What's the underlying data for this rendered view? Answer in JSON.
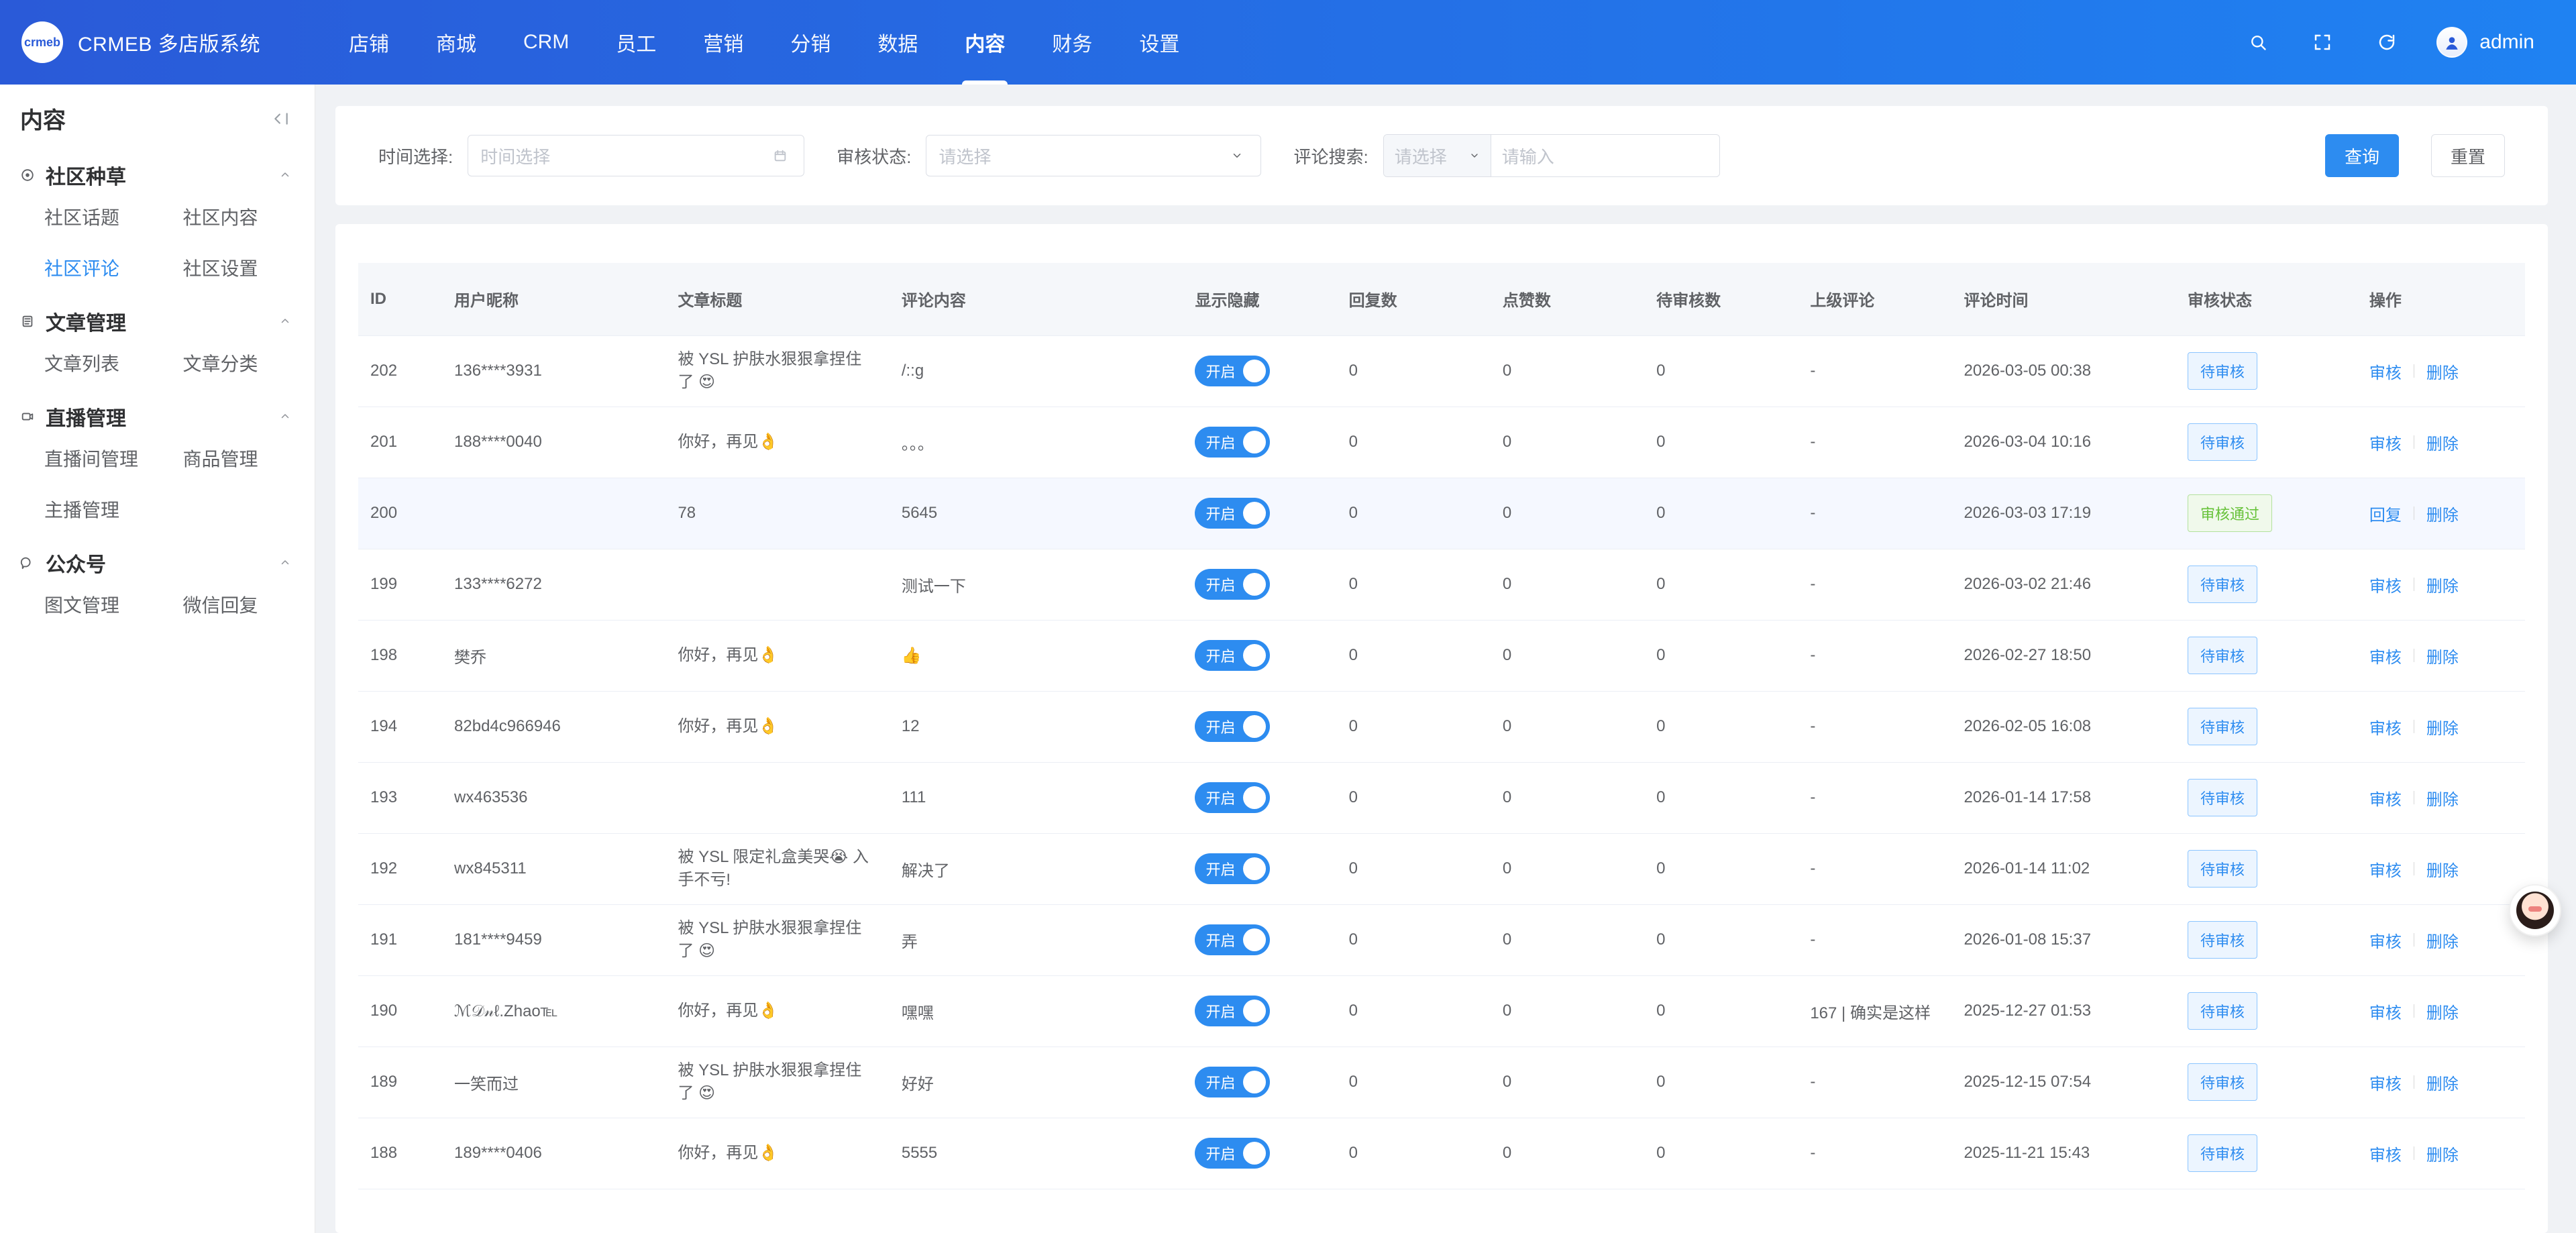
{
  "brand": {
    "logo_text": "crmeb",
    "title": "CRMEB 多店版系统"
  },
  "topnav": {
    "items": [
      {
        "label": "店铺",
        "active": false
      },
      {
        "label": "商城",
        "active": false
      },
      {
        "label": "CRM",
        "active": false
      },
      {
        "label": "员工",
        "active": false
      },
      {
        "label": "营销",
        "active": false
      },
      {
        "label": "分销",
        "active": false
      },
      {
        "label": "数据",
        "active": false
      },
      {
        "label": "内容",
        "active": true
      },
      {
        "label": "财务",
        "active": false
      },
      {
        "label": "设置",
        "active": false
      }
    ],
    "user": {
      "name": "admin"
    }
  },
  "sidebar": {
    "title": "内容",
    "groups": [
      {
        "title": "社区种草",
        "icon": "community-icon",
        "items": [
          {
            "label": "社区话题",
            "active": false
          },
          {
            "label": "社区内容",
            "active": false
          },
          {
            "label": "社区评论",
            "active": true
          },
          {
            "label": "社区设置",
            "active": false
          }
        ]
      },
      {
        "title": "文章管理",
        "icon": "document-icon",
        "items": [
          {
            "label": "文章列表",
            "active": false
          },
          {
            "label": "文章分类",
            "active": false
          }
        ]
      },
      {
        "title": "直播管理",
        "icon": "live-icon",
        "items": [
          {
            "label": "直播间管理",
            "active": false
          },
          {
            "label": "商品管理",
            "active": false
          },
          {
            "label": "主播管理",
            "active": false
          }
        ]
      },
      {
        "title": "公众号",
        "icon": "chat-icon",
        "items": [
          {
            "label": "图文管理",
            "active": false
          },
          {
            "label": "微信回复",
            "active": false
          }
        ]
      }
    ]
  },
  "filters": {
    "time": {
      "label": "时间选择:",
      "placeholder": "时间选择"
    },
    "status": {
      "label": "审核状态:",
      "placeholder": "请选择"
    },
    "comment": {
      "label": "评论搜索:",
      "select_placeholder": "请选择",
      "input_placeholder": "请输入"
    },
    "buttons": {
      "query": "查询",
      "reset": "重置"
    }
  },
  "table": {
    "headers": [
      "ID",
      "用户昵称",
      "文章标题",
      "评论内容",
      "显示隐藏",
      "回复数",
      "点赞数",
      "待审核数",
      "上级评论",
      "评论时间",
      "审核状态",
      "操作"
    ],
    "switch_label": "开启",
    "ops": {
      "audit": "审核",
      "reply": "回复",
      "delete": "删除"
    },
    "rows": [
      {
        "id": "202",
        "nick": "136****3931",
        "title": "被 YSL 护肤水狠狠拿捏住了 😍",
        "content": "/::g",
        "replies": "0",
        "likes": "0",
        "pending": "0",
        "parent": "-",
        "time": "2026-03-05 00:38",
        "status": "待审核",
        "status_type": "pending",
        "ops_type": "audit"
      },
      {
        "id": "201",
        "nick": "188****0040",
        "title": "你好，再见👌",
        "content": "。。。",
        "replies": "0",
        "likes": "0",
        "pending": "0",
        "parent": "-",
        "time": "2026-03-04 10:16",
        "status": "待审核",
        "status_type": "pending",
        "ops_type": "audit"
      },
      {
        "id": "200",
        "nick": "",
        "title": "78",
        "content": "5645",
        "replies": "0",
        "likes": "0",
        "pending": "0",
        "parent": "-",
        "time": "2026-03-03 17:19",
        "status": "审核通过",
        "status_type": "pass",
        "ops_type": "reply",
        "highlight": true
      },
      {
        "id": "199",
        "nick": "133****6272",
        "title": "",
        "content": "测试一下",
        "replies": "0",
        "likes": "0",
        "pending": "0",
        "parent": "-",
        "time": "2026-03-02 21:46",
        "status": "待审核",
        "status_type": "pending",
        "ops_type": "audit"
      },
      {
        "id": "198",
        "nick": "樊乔",
        "title": "你好，再见👌",
        "content": "👍",
        "replies": "0",
        "likes": "0",
        "pending": "0",
        "parent": "-",
        "time": "2026-02-27 18:50",
        "status": "待审核",
        "status_type": "pending",
        "ops_type": "audit"
      },
      {
        "id": "194",
        "nick": "82bd4c966946",
        "title": "你好，再见👌",
        "content": "12",
        "replies": "0",
        "likes": "0",
        "pending": "0",
        "parent": "-",
        "time": "2026-02-05 16:08",
        "status": "待审核",
        "status_type": "pending",
        "ops_type": "audit"
      },
      {
        "id": "193",
        "nick": "wx463536",
        "title": "",
        "content": "111",
        "replies": "0",
        "likes": "0",
        "pending": "0",
        "parent": "-",
        "time": "2026-01-14 17:58",
        "status": "待审核",
        "status_type": "pending",
        "ops_type": "audit"
      },
      {
        "id": "192",
        "nick": "wx845311",
        "title": "被 YSL 限定礼盒美哭😭 入手不亏!",
        "content": "解决了",
        "replies": "0",
        "likes": "0",
        "pending": "0",
        "parent": "-",
        "time": "2026-01-14 11:02",
        "status": "待审核",
        "status_type": "pending",
        "ops_type": "audit"
      },
      {
        "id": "191",
        "nick": "181****9459",
        "title": "被 YSL 护肤水狠狠拿捏住了 😍",
        "content": "弄",
        "replies": "0",
        "likes": "0",
        "pending": "0",
        "parent": "-",
        "time": "2026-01-08 15:37",
        "status": "待审核",
        "status_type": "pending",
        "ops_type": "audit"
      },
      {
        "id": "190",
        "nick": "ℳ𝒟𝓃ℓ.Zhao℡",
        "title": "你好，再见👌",
        "content": "嘿嘿",
        "replies": "0",
        "likes": "0",
        "pending": "0",
        "parent": "167 | 确实是这样",
        "time": "2025-12-27 01:53",
        "status": "待审核",
        "status_type": "pending",
        "ops_type": "audit"
      },
      {
        "id": "189",
        "nick": "一笑而过",
        "title": "被 YSL 护肤水狠狠拿捏住了 😍",
        "content": "好好",
        "replies": "0",
        "likes": "0",
        "pending": "0",
        "parent": "-",
        "time": "2025-12-15 07:54",
        "status": "待审核",
        "status_type": "pending",
        "ops_type": "audit"
      },
      {
        "id": "188",
        "nick": "189****0406",
        "title": "你好，再见👌",
        "content": "5555",
        "replies": "0",
        "likes": "0",
        "pending": "0",
        "parent": "-",
        "time": "2025-11-21 15:43",
        "status": "待审核",
        "status_type": "pending",
        "ops_type": "audit"
      }
    ]
  }
}
